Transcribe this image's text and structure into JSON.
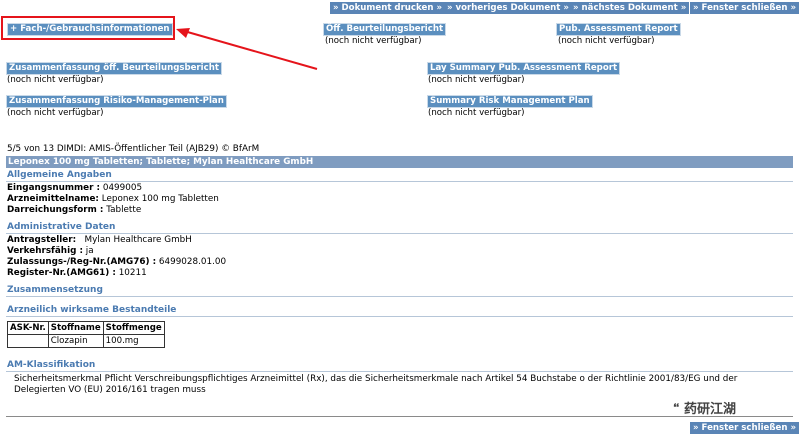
{
  "toolbar": {
    "print": "» Dokument drucken »",
    "prev": "» vorheriges Dokument »",
    "next": "» nächstes Dokument »",
    "close": "» Fenster schließen »"
  },
  "links": {
    "fach": "+ Fach-/Gebrauchsinformationen",
    "oeff": "Öff. Beurteilungsbericht",
    "oeff_na": "(noch nicht verfügbar)",
    "pub": "Pub. Assessment Report",
    "pub_na": "(noch nicht verfügbar)",
    "zus_oeff": "Zusammenfassung öff. Beurteilungsbericht",
    "zus_oeff_na": "(noch nicht verfügbar)",
    "lay": "Lay Summary Pub. Assessment Report",
    "lay_na": "(noch nicht verfügbar)",
    "zus_risk": "Zusammenfassung Risiko-Management-Plan",
    "zus_risk_na": "(noch nicht verfügbar)",
    "summary_risk": "Summary Risk Management Plan",
    "summary_risk_na": "(noch nicht verfügbar)"
  },
  "doc": {
    "position": "5/5 von 13  DIMDI: AMIS-Öffentlicher Teil (AJB29) © BfArM",
    "title": "Leponex 100 mg Tabletten; Tablette; Mylan Healthcare GmbH"
  },
  "allgemein": {
    "heading": "Allgemeine Angaben",
    "eingangsnummer_label": "Eingangsnummer :",
    "eingangsnummer": "0499005",
    "arzneimittelname_label": "Arzneimittelname:",
    "arzneimittelname": "Leponex 100 mg Tabletten",
    "darreichungsform_label": "Darreichungsform :",
    "darreichungsform": "Tablette"
  },
  "admin": {
    "heading": "Administrative Daten",
    "antragsteller_label": "Antragsteller:",
    "antragsteller": "Mylan Healthcare GmbH",
    "verkehrsfaehig_label": "Verkehrsfähig :",
    "verkehrsfaehig": "ja",
    "zulassung_label": "Zulassungs-/Reg-Nr.(AMG76) :",
    "zulassung": "6499028.01.00",
    "register_label": "Register-Nr.(AMG61) :",
    "register": "10211"
  },
  "zusammensetzung": {
    "heading": "Zusammensetzung"
  },
  "bestandteile": {
    "heading": "Arzneilich wirksame Bestandteile",
    "headers": [
      "ASK-Nr.",
      "Stoffname",
      "Stoffmenge"
    ],
    "rows": [
      [
        "",
        "Clozapin",
        "100.mg"
      ]
    ]
  },
  "am": {
    "heading": "AM-Klassifikation",
    "text": "Sicherheitsmerkmal Pflicht Verschreibungspflichtiges Arzneimittel (Rx), das die Sicherheitsmerkmale nach Artikel 54 Buchstabe o der Richtlinie 2001/83/EG und der Delegierten VO (EU) 2016/161 tragen muss"
  },
  "watermark": "🙶 药研江湖",
  "colors": {
    "accent": "#5a85b6",
    "highlight": "#e5141b",
    "section": "#4b7bb1"
  }
}
